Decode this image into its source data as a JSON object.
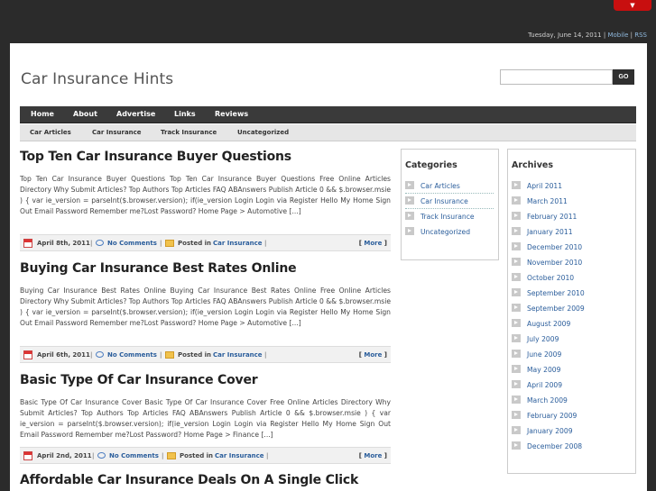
{
  "topbar": {
    "red_tab_glyph": "▼",
    "date_text": "Tuesday, June 14, 2011 | ",
    "mobile_label": "Mobile",
    "rss_sep": " | ",
    "rss_label": "RSS"
  },
  "header": {
    "site_title": "Car Insurance Hints",
    "search_placeholder": "",
    "search_button": "GO"
  },
  "nav": {
    "items": [
      "Home",
      "About",
      "Advertise",
      "Links",
      "Reviews"
    ]
  },
  "subnav": {
    "items": [
      "Car Articles",
      "Car Insurance",
      "Track Insurance",
      "Uncategorized"
    ]
  },
  "posts": [
    {
      "title": "Top Ten Car Insurance Buyer Questions",
      "excerpt": "Top Ten Car Insurance Buyer Questions Top Ten Car Insurance Buyer Questions Free Online Articles Directory Why Submit Articles? Top Authors Top Articles FAQ ABAnswers Publish Article 0 && $.browser.msie ) { var ie_version = parseInt($.browser.version); if(ie_version Login Login via Register Hello My Home Sign Out Email Password Remember me?Lost Password? Home Page > Automotive [...]",
      "date": "April 8th, 2011",
      "comments": "No Comments",
      "posted_in": "Posted in",
      "category": "Car Insurance",
      "more": "More"
    },
    {
      "title": "Buying Car Insurance Best Rates Online",
      "excerpt": "Buying Car Insurance Best Rates Online Buying Car Insurance Best Rates Online Free Online Articles Directory Why Submit Articles? Top Authors Top Articles FAQ ABAnswers Publish Article 0 && $.browser.msie ) { var ie_version = parseInt($.browser.version); if(ie_version Login Login via Register Hello My Home Sign Out Email Password Remember me?Lost Password? Home Page > Automotive [...]",
      "date": "April 6th, 2011",
      "comments": "No Comments",
      "posted_in": "Posted in",
      "category": "Car Insurance",
      "more": "More"
    },
    {
      "title": "Basic Type Of Car Insurance Cover",
      "excerpt": "Basic Type Of Car Insurance Cover Basic Type Of Car Insurance Cover Free Online Articles Directory Why Submit Articles? Top Authors Top Articles FAQ ABAnswers Publish Article 0 && $.browser.msie ) { var ie_version = parseInt($.browser.version); if(ie_version Login Login via Register Hello My Home Sign Out Email Password Remember me?Lost Password? Home Page > Finance [...]",
      "date": "April 2nd, 2011",
      "comments": "No Comments",
      "posted_in": "Posted in",
      "category": "Car Insurance",
      "more": "More"
    },
    {
      "title": "Affordable Car Insurance Deals On A Single Click"
    }
  ],
  "categories": {
    "title": "Categories",
    "items": [
      "Car Articles",
      "Car Insurance",
      "Track Insurance",
      "Uncategorized"
    ]
  },
  "archives": {
    "title": "Archives",
    "items": [
      "April 2011",
      "March 2011",
      "February 2011",
      "January 2011",
      "December 2010",
      "November 2010",
      "October 2010",
      "September 2010",
      "September 2009",
      "August 2009",
      "July 2009",
      "June 2009",
      "May 2009",
      "April 2009",
      "March 2009",
      "February 2009",
      "January 2009",
      "December 2008"
    ]
  }
}
